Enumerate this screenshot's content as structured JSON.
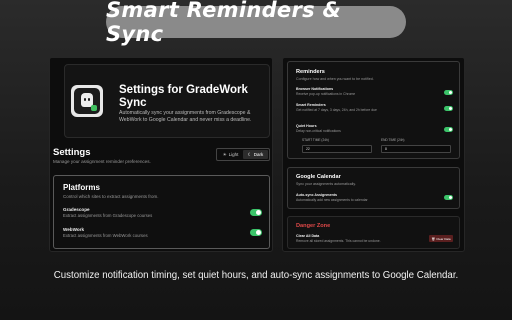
{
  "banner": {
    "title": "Smart Reminders & Sync"
  },
  "left": {
    "hero_title": "Settings for GradeWork Sync",
    "hero_desc": "Automatically sync your assignments from Gradescope & WebWork to Google Calendar and never miss a deadline.",
    "settings_title": "Settings",
    "settings_sub": "Manage your assignment reminder preferences.",
    "theme": {
      "light": "Light",
      "dark": "Dark",
      "selected": "Dark"
    },
    "platforms": {
      "title": "Platforms",
      "desc": "Control which sites to extract assignments from.",
      "items": [
        {
          "name": "Gradescope",
          "desc": "Extract assignments from Gradescope courses",
          "enabled": true
        },
        {
          "name": "WebWork",
          "desc": "Extract assignments from WebWork courses",
          "enabled": true
        }
      ]
    }
  },
  "right": {
    "reminders": {
      "title": "Reminders",
      "sub": "Configure how and when you want to be notified.",
      "items": [
        {
          "name": "Browser Notifications",
          "desc": "Receive pop-up notifications in Chrome",
          "enabled": true
        },
        {
          "name": "Smart Reminders",
          "desc": "Get notified at 7 days, 3 days, 24h, and 2h before due",
          "enabled": true
        },
        {
          "name": "Quiet Hours",
          "desc": "Delay non-critical notifications",
          "enabled": true
        }
      ],
      "quiet_start_label": "START TIME (24h)",
      "quiet_start_value": "22",
      "quiet_end_label": "END TIME (24h)",
      "quiet_end_value": "8"
    },
    "calendar": {
      "title": "Google Calendar",
      "sub": "Sync your assignments automatically.",
      "item": {
        "name": "Auto-sync Assignments",
        "desc": "Automatically add new assignments to calendar",
        "enabled": true
      }
    },
    "danger": {
      "title": "Danger Zone",
      "item_name": "Clear All Data",
      "item_desc": "Remove all stored assignments. This cannot be undone.",
      "button": "Clear Data"
    }
  },
  "caption": "Customize notification timing, set quiet hours, and auto-sync assignments to Google Calendar.",
  "colors": {
    "toggle_on": "#3cc46a",
    "danger": "#e04848",
    "pill": "#8a8a8a"
  }
}
